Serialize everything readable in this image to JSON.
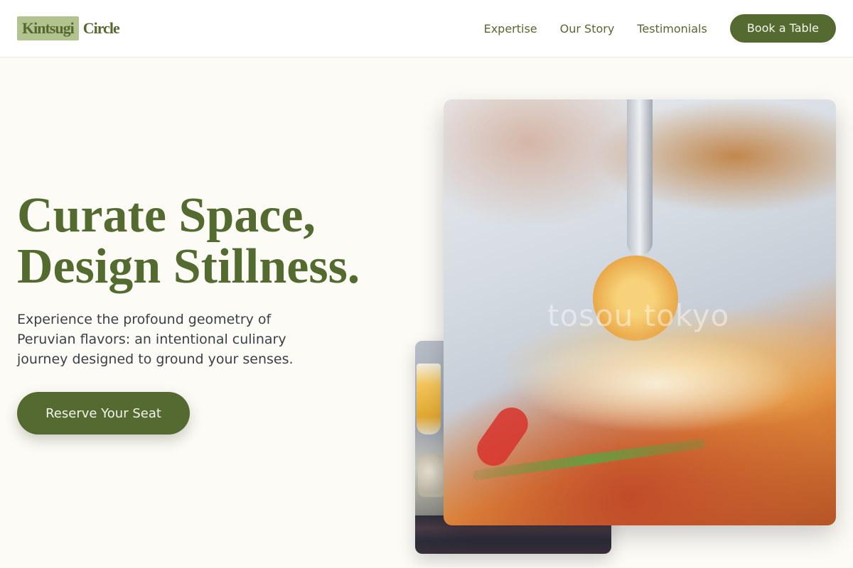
{
  "brand": {
    "logo_mark": "Kintsugi",
    "logo_rest": "Circle"
  },
  "nav": {
    "links": [
      "Expertise",
      "Our Story",
      "Testimonials"
    ],
    "cta": "Book a Table"
  },
  "hero": {
    "title_line1": "Curate Space,",
    "title_line2": "Design Stillness.",
    "subtitle": "Experience the profound geometry of Peruvian flavors: an intentional culinary journey designed to ground your senses.",
    "cta": "Reserve Your Seat"
  },
  "images": {
    "main_photo_watermark": "tosou tokyo"
  },
  "colors": {
    "accent": "#556a31",
    "logo_highlight": "#b3c38f",
    "background": "#fcfbf6"
  }
}
